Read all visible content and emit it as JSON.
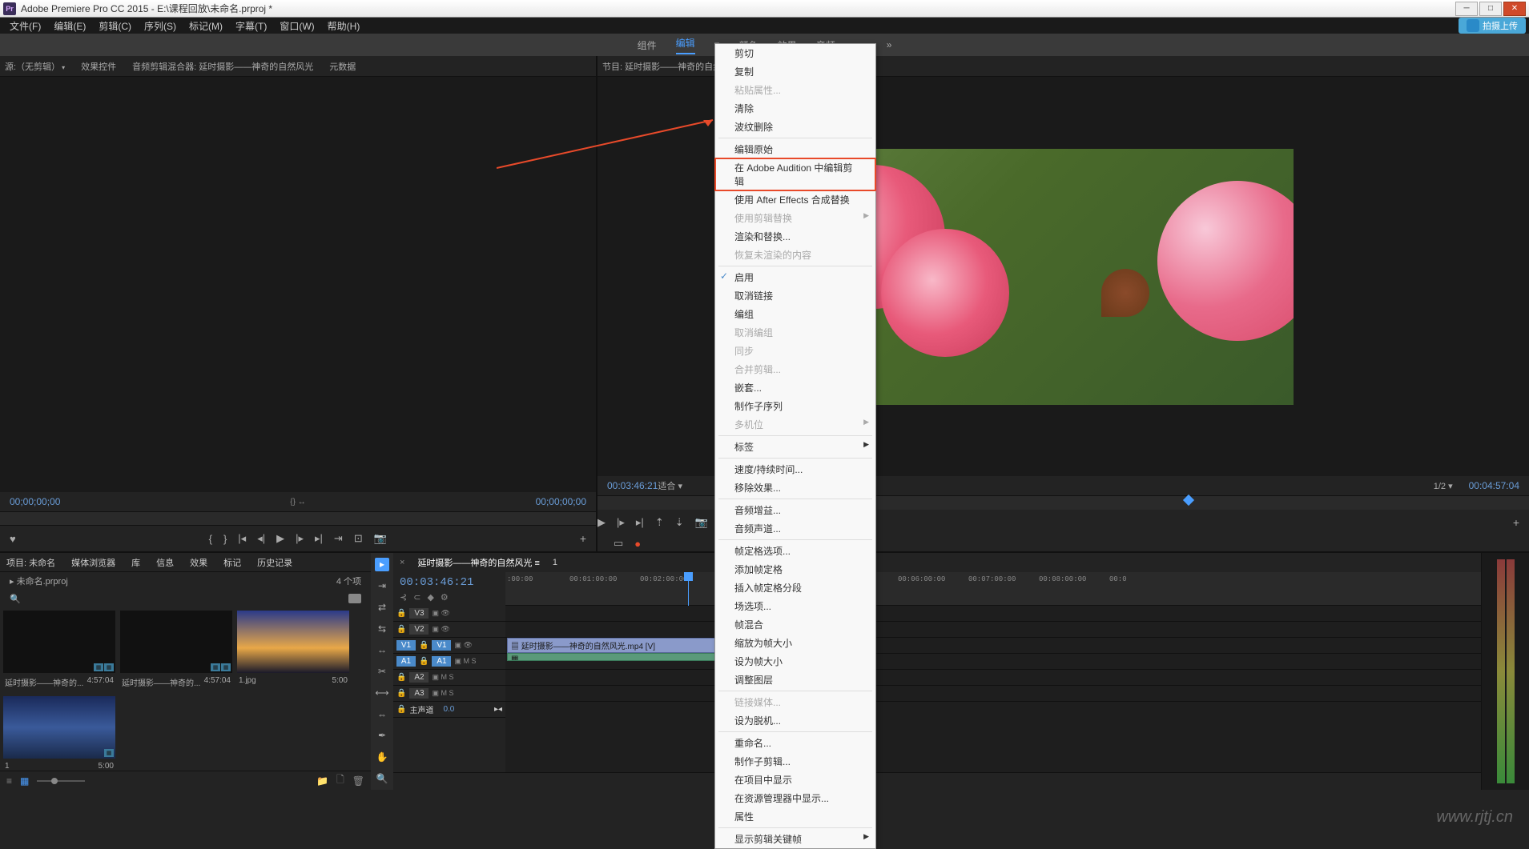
{
  "titleBar": {
    "appName": "Adobe Premiere Pro CC 2015",
    "filePath": "E:\\课程回放\\未命名.prproj",
    "fullTitle": "Adobe Premiere Pro CC 2015 - E:\\课程回放\\未命名.prproj *"
  },
  "menuBar": {
    "items": [
      "文件(F)",
      "编辑(E)",
      "剪辑(C)",
      "序列(S)",
      "标记(M)",
      "字幕(T)",
      "窗口(W)",
      "帮助(H)"
    ],
    "shareLabel": "拍摄上传"
  },
  "workspaces": {
    "items": [
      "组件",
      "编辑",
      "颜色",
      "效果",
      "音频"
    ],
    "activeIndex": 1
  },
  "sourcePanel": {
    "tabs": [
      "源:（无剪辑）",
      "效果控件",
      "音频剪辑混合器: 延时摄影——神奇的自然风光",
      "元数据"
    ],
    "timeLeft": "00;00;00;00",
    "timeRight": "00;00;00;00",
    "tinyIcons": [
      "{}"
    ]
  },
  "programPanel": {
    "title": "节目: 延时摄影——神奇的自然风",
    "timeLeft": "00:03:46:21",
    "fitLabel": "适合",
    "zoomLabel": "1/2",
    "timeRight": "00:04:57:04"
  },
  "projectPanel": {
    "tabs": [
      "项目: 未命名",
      "媒体浏览器",
      "库",
      "信息",
      "效果",
      "标记",
      "历史记录"
    ],
    "projectFile": "未命名.prproj",
    "itemCount": "4 个项",
    "clips": [
      {
        "name": "延时摄影——神奇的...",
        "duration": "4:57:04",
        "type": "av"
      },
      {
        "name": "延时摄影——神奇的...",
        "duration": "4:57:04",
        "type": "av"
      },
      {
        "name": "1.jpg",
        "duration": "5:00",
        "type": "img"
      },
      {
        "name": "1",
        "duration": "5:00",
        "type": "img"
      }
    ]
  },
  "timeline": {
    "sequenceName": "延时摄影——神奇的自然风光",
    "tab2": "1",
    "currentTime": "00:03:46:21",
    "ticks": [
      ":00:00",
      "00:01:00:00",
      "00:02:00:00",
      "00:06:00:00",
      "00:07:00:00",
      "00:08:00:00",
      "00:0"
    ],
    "tracks": {
      "video": [
        "V3",
        "V2",
        "V1"
      ],
      "audio": [
        "A1",
        "A2",
        "A3"
      ],
      "master": "主声道",
      "masterVal": "0.0"
    },
    "clipName": "延时摄影——神奇的自然风光.mp4 [V]",
    "sourcePatches": {
      "v": "V1",
      "a": "A1"
    }
  },
  "contextMenu": {
    "items": [
      {
        "label": "剪切",
        "type": "item"
      },
      {
        "label": "复制",
        "type": "item"
      },
      {
        "label": "粘贴属性...",
        "type": "disabled"
      },
      {
        "label": "清除",
        "type": "item"
      },
      {
        "label": "波纹删除",
        "type": "item"
      },
      {
        "type": "sep"
      },
      {
        "label": "编辑原始",
        "type": "item"
      },
      {
        "label": "在 Adobe Audition 中编辑剪辑",
        "type": "highlighted"
      },
      {
        "label": "使用 After Effects 合成替换",
        "type": "item"
      },
      {
        "label": "使用剪辑替换",
        "type": "disabled",
        "sub": true
      },
      {
        "label": "渲染和替换...",
        "type": "item"
      },
      {
        "label": "恢复未渲染的内容",
        "type": "disabled"
      },
      {
        "type": "sep"
      },
      {
        "label": "启用",
        "type": "checked"
      },
      {
        "label": "取消链接",
        "type": "item"
      },
      {
        "label": "编组",
        "type": "item"
      },
      {
        "label": "取消编组",
        "type": "disabled"
      },
      {
        "label": "同步",
        "type": "disabled"
      },
      {
        "label": "合并剪辑...",
        "type": "disabled"
      },
      {
        "label": "嵌套...",
        "type": "item"
      },
      {
        "label": "制作子序列",
        "type": "item"
      },
      {
        "label": "多机位",
        "type": "disabled",
        "sub": true
      },
      {
        "type": "sep"
      },
      {
        "label": "标签",
        "type": "item",
        "sub": true
      },
      {
        "type": "sep"
      },
      {
        "label": "速度/持续时间...",
        "type": "item"
      },
      {
        "label": "移除效果...",
        "type": "item"
      },
      {
        "type": "sep"
      },
      {
        "label": "音频增益...",
        "type": "item"
      },
      {
        "label": "音频声道...",
        "type": "item"
      },
      {
        "type": "sep"
      },
      {
        "label": "帧定格选项...",
        "type": "item"
      },
      {
        "label": "添加帧定格",
        "type": "item"
      },
      {
        "label": "插入帧定格分段",
        "type": "item"
      },
      {
        "label": "场选项...",
        "type": "item"
      },
      {
        "label": "帧混合",
        "type": "item"
      },
      {
        "label": "缩放为帧大小",
        "type": "item"
      },
      {
        "label": "设为帧大小",
        "type": "item"
      },
      {
        "label": "调整图层",
        "type": "item"
      },
      {
        "type": "sep"
      },
      {
        "label": "链接媒体...",
        "type": "disabled"
      },
      {
        "label": "设为脱机...",
        "type": "item"
      },
      {
        "type": "sep"
      },
      {
        "label": "重命名...",
        "type": "item"
      },
      {
        "label": "制作子剪辑...",
        "type": "item"
      },
      {
        "label": "在项目中显示",
        "type": "item"
      },
      {
        "label": "在资源管理器中显示...",
        "type": "item"
      },
      {
        "label": "属性",
        "type": "item"
      },
      {
        "type": "sep"
      },
      {
        "label": "显示剪辑关键帧",
        "type": "item",
        "sub": true
      }
    ]
  },
  "watermark": "www.rjtj.cn"
}
